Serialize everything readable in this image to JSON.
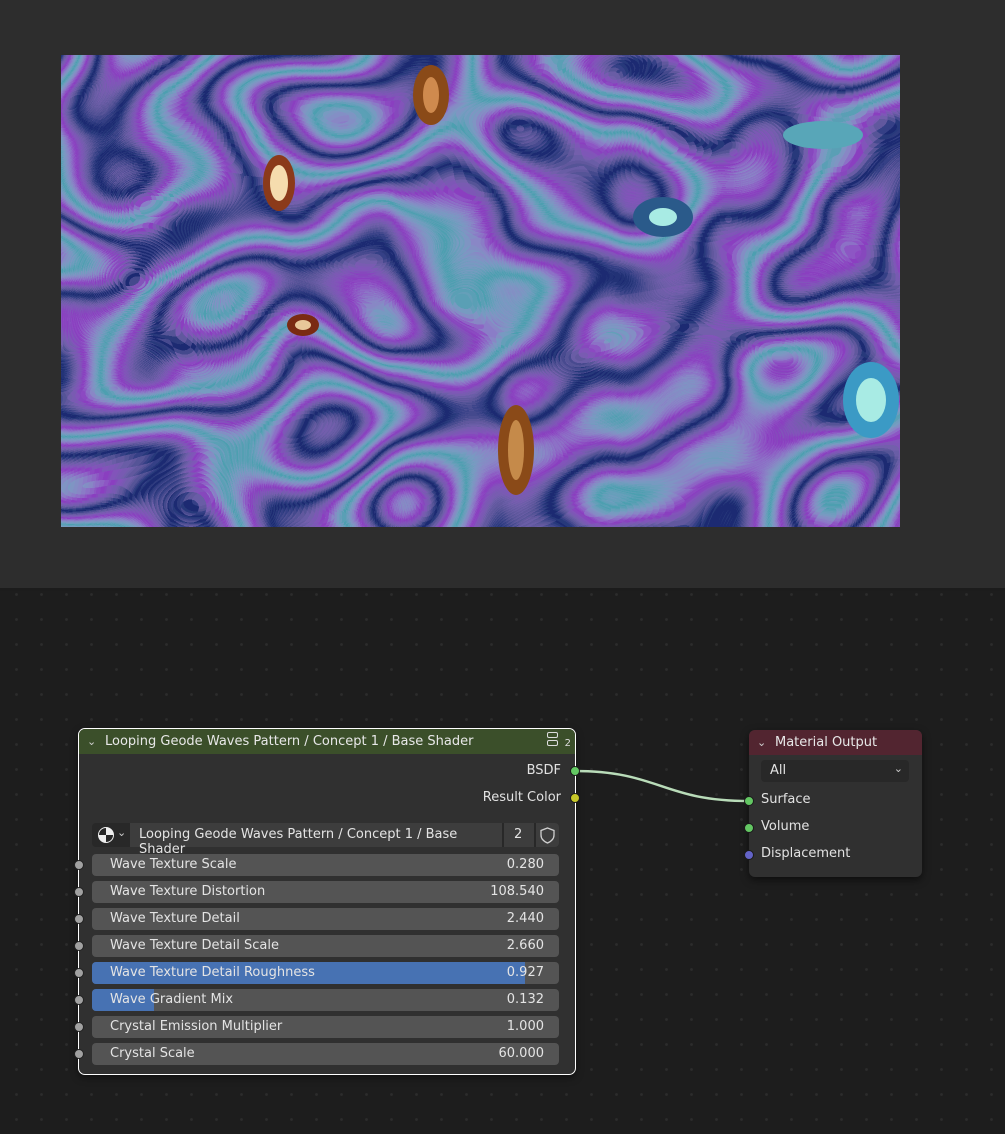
{
  "group_node": {
    "title": "Looping Geode Waves Pattern / Concept 1 / Base Shader",
    "user_count": "2",
    "outputs": [
      {
        "label": "BSDF",
        "color": "#63c763"
      },
      {
        "label": "Result Color",
        "color": "#c7c729"
      }
    ],
    "datablock": {
      "name": "Looping Geode Waves Pattern / Concept 1 / Base Shader",
      "users": "2",
      "icon": "node-tree-sphere-icon",
      "fake_user_icon": "shield-icon"
    },
    "inputs": [
      {
        "label": "Wave Texture Scale",
        "value": "0.280",
        "fill": 0
      },
      {
        "label": "Wave Texture Distortion",
        "value": "108.540",
        "fill": 0
      },
      {
        "label": "Wave Texture Detail",
        "value": "2.440",
        "fill": 0
      },
      {
        "label": "Wave Texture Detail Scale",
        "value": "2.660",
        "fill": 0
      },
      {
        "label": "Wave Texture Detail Roughness",
        "value": "0.927",
        "fill": 0.927
      },
      {
        "label": "Wave Gradient Mix",
        "value": "0.132",
        "fill": 0.132
      },
      {
        "label": "Crystal Emission Multiplier",
        "value": "1.000",
        "fill": 0
      },
      {
        "label": "Crystal Scale",
        "value": "60.000",
        "fill": 0
      }
    ],
    "header_color": "#3b4f2a"
  },
  "material_output": {
    "title": "Material Output",
    "target": "All",
    "inputs": [
      {
        "label": "Surface",
        "color": "#63c763"
      },
      {
        "label": "Volume",
        "color": "#63c763"
      },
      {
        "label": "Displacement",
        "color": "#6363c7"
      }
    ],
    "header_color": "#522530"
  },
  "colors": {
    "link": "#b9dcb9",
    "selected_outline": "#ffffff",
    "slider_fill": "#4772b3"
  }
}
